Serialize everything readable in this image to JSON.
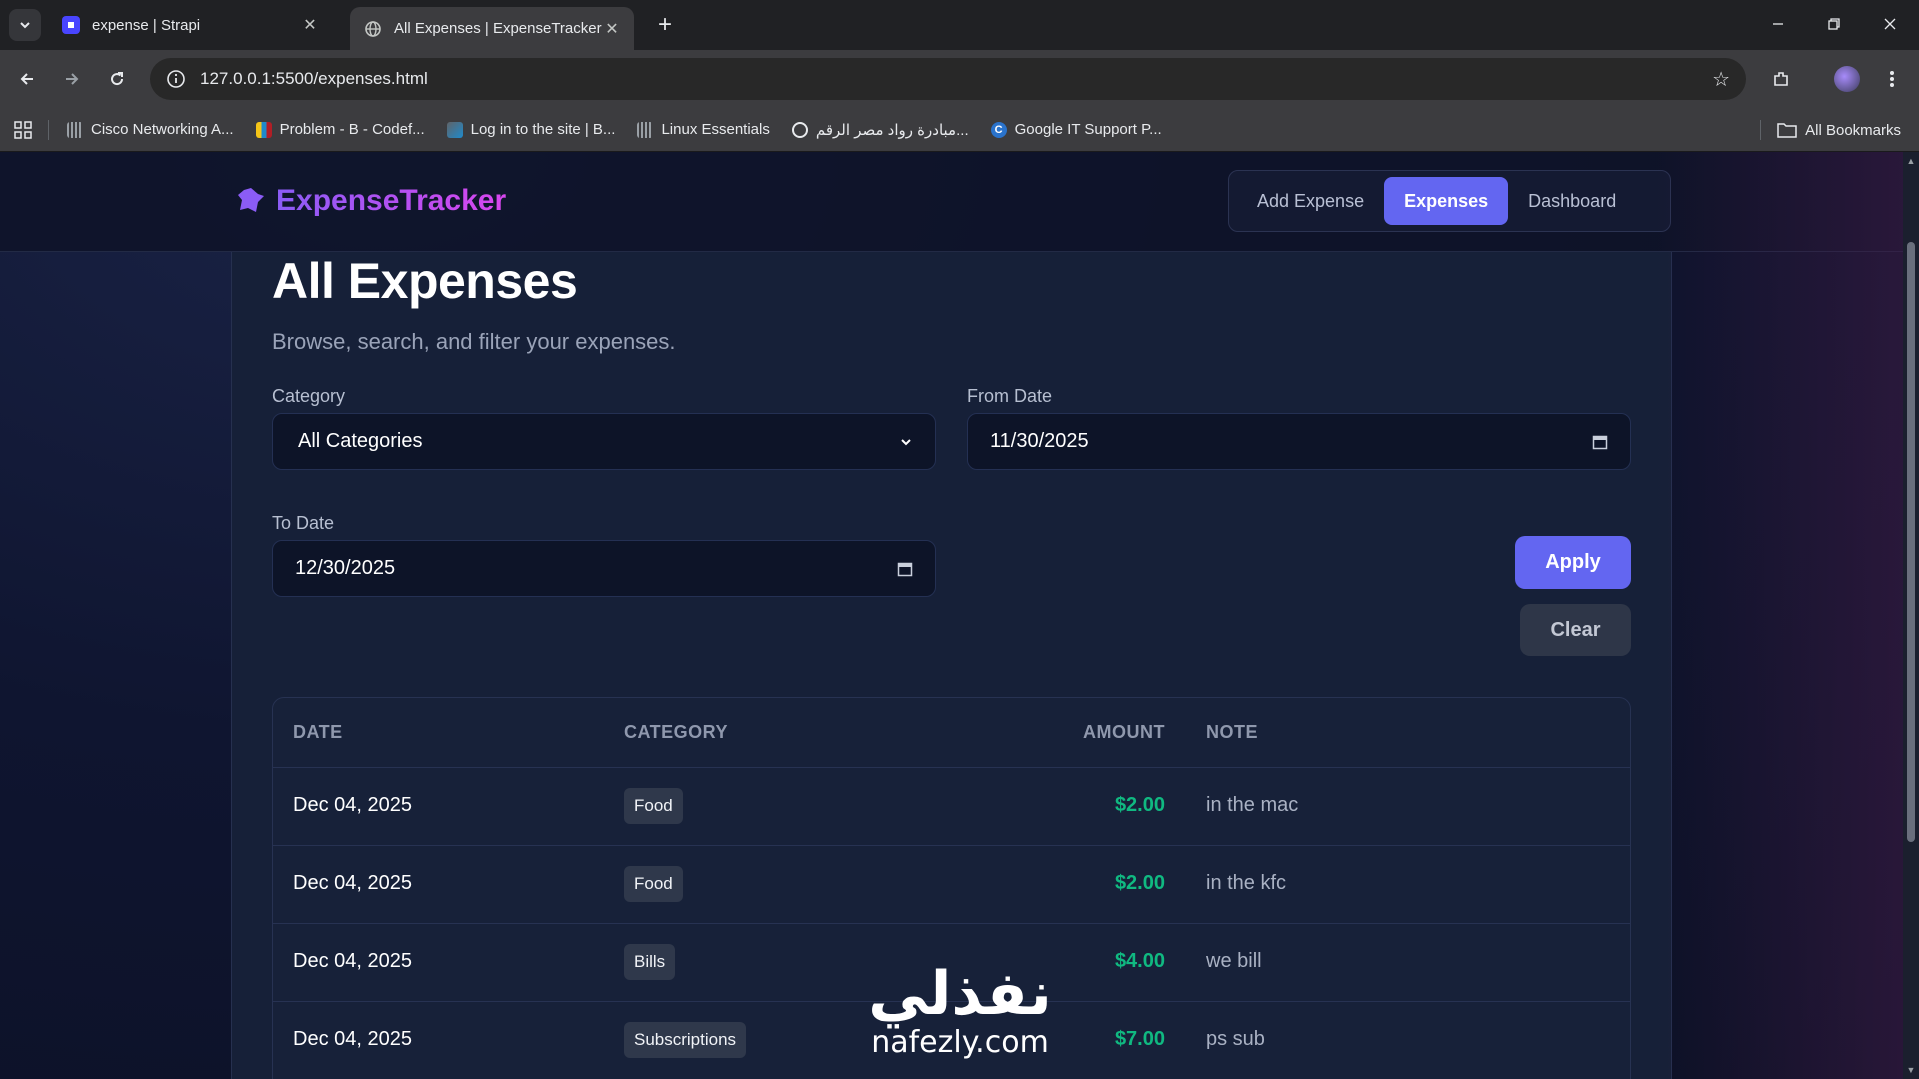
{
  "browser": {
    "tabs": [
      {
        "title": "expense | Strapi",
        "active": false
      },
      {
        "title": "All Expenses | ExpenseTracker",
        "active": true
      }
    ],
    "url": "127.0.0.1:5500/expenses.html",
    "bookmarks": [
      "Cisco Networking A...",
      "Problem - B - Codef...",
      "Log in to the site | B...",
      "Linux Essentials",
      "مبادرة رواد مصر الرقم...",
      "Google IT Support P..."
    ],
    "all_bookmarks": "All Bookmarks"
  },
  "app": {
    "brand": "ExpenseTracker",
    "nav": [
      "Add Expense",
      "Expenses",
      "Dashboard"
    ],
    "active_nav": "Expenses",
    "accent": "#6366f1"
  },
  "page": {
    "title": "All Expenses",
    "subtitle": "Browse, search, and filter your expenses."
  },
  "filters": {
    "category_label": "Category",
    "category_value": "All Categories",
    "from_label": "From Date",
    "from_value": "11/30/2025",
    "to_label": "To Date",
    "to_value": "12/30/2025",
    "apply": "Apply",
    "clear": "Clear"
  },
  "table": {
    "headers": [
      "DATE",
      "CATEGORY",
      "AMOUNT",
      "NOTE"
    ],
    "rows": [
      {
        "date": "Dec 04, 2025",
        "category": "Food",
        "amount": "$2.00",
        "note": "in the mac"
      },
      {
        "date": "Dec 04, 2025",
        "category": "Food",
        "amount": "$2.00",
        "note": "in the kfc"
      },
      {
        "date": "Dec 04, 2025",
        "category": "Bills",
        "amount": "$4.00",
        "note": "we bill"
      },
      {
        "date": "Dec 04, 2025",
        "category": "Subscriptions",
        "amount": "$7.00",
        "note": "ps sub"
      }
    ]
  },
  "watermark": {
    "arabic": "نفذلي",
    "latin": "nafezly.com"
  }
}
